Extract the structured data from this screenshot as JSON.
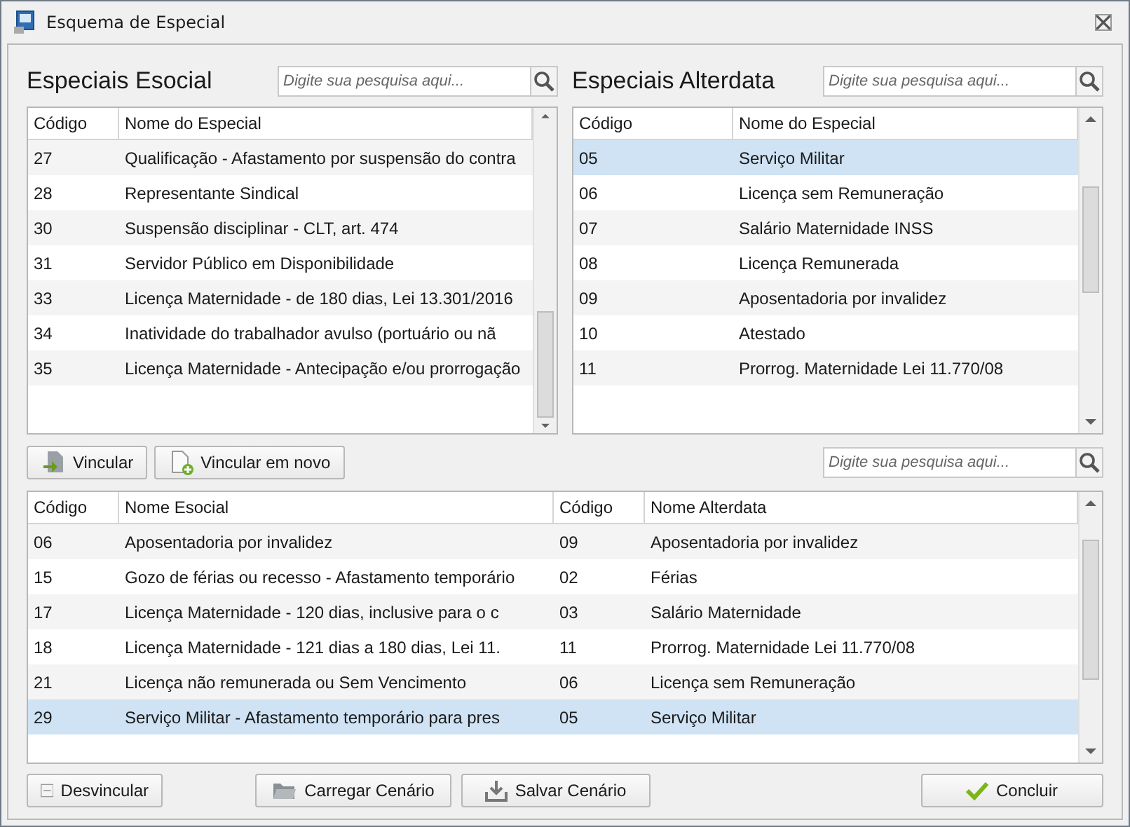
{
  "window": {
    "title": "Esquema de Especial"
  },
  "esocial": {
    "title": "Especiais Esocial",
    "search": {
      "placeholder": "Digite sua pesquisa aqui..."
    },
    "columns": [
      "Código",
      "Nome do Especial"
    ],
    "rows": [
      {
        "code": "27",
        "name": "Qualificação - Afastamento por suspensão do contra",
        "selected": false
      },
      {
        "code": "28",
        "name": "Representante Sindical",
        "selected": false
      },
      {
        "code": "30",
        "name": "Suspensão disciplinar - CLT, art. 474",
        "selected": false
      },
      {
        "code": "31",
        "name": "Servidor Público em Disponibilidade",
        "selected": false
      },
      {
        "code": "33",
        "name": "Licença Maternidade - de 180 dias, Lei 13.301/2016",
        "selected": false
      },
      {
        "code": "34",
        "name": "Inatividade do trabalhador avulso (portuário ou nã",
        "selected": false
      },
      {
        "code": "35",
        "name": "Licença Maternidade - Antecipação e/ou prorrogação",
        "selected": false
      }
    ]
  },
  "alterdata": {
    "title": "Especiais Alterdata",
    "search": {
      "placeholder": "Digite sua pesquisa aqui..."
    },
    "columns": [
      "Código",
      "Nome do Especial"
    ],
    "rows": [
      {
        "code": "05",
        "name": "Serviço Militar",
        "selected": true
      },
      {
        "code": "06",
        "name": "Licença sem Remuneração",
        "selected": false
      },
      {
        "code": "07",
        "name": "Salário Maternidade INSS",
        "selected": false
      },
      {
        "code": "08",
        "name": "Licença Remunerada",
        "selected": false
      },
      {
        "code": "09",
        "name": "Aposentadoria por invalidez",
        "selected": false
      },
      {
        "code": "10",
        "name": "Atestado",
        "selected": false
      },
      {
        "code": "11",
        "name": "Prorrog. Maternidade Lei 11.770/08",
        "selected": false
      }
    ]
  },
  "link_buttons": [
    {
      "label": "Vincular",
      "kind": "link"
    },
    {
      "label": "Vincular em novo",
      "kind": "new"
    }
  ],
  "links": {
    "search": {
      "placeholder": "Digite sua pesquisa aqui..."
    },
    "columns": [
      "Código",
      "Nome Esocial",
      "Código",
      "Nome Alterdata"
    ],
    "rows": [
      {
        "cells": [
          "06",
          "Aposentadoria por invalidez",
          "09",
          "Aposentadoria por invalidez"
        ],
        "selected": false
      },
      {
        "cells": [
          "15",
          "Gozo de férias ou recesso - Afastamento temporário",
          "02",
          "Férias"
        ],
        "selected": false
      },
      {
        "cells": [
          "17",
          "Licença Maternidade - 120 dias, inclusive para o c",
          "03",
          "Salário Maternidade"
        ],
        "selected": false
      },
      {
        "cells": [
          "18",
          "Licença Maternidade - 121 dias a 180 dias, Lei 11.",
          "11",
          "Prorrog. Maternidade Lei 11.770/08"
        ],
        "selected": false
      },
      {
        "cells": [
          "21",
          "Licença não remunerada ou Sem Vencimento",
          "06",
          "Licença sem Remuneração"
        ],
        "selected": false
      },
      {
        "cells": [
          "29",
          "Serviço Militar - Afastamento temporário para pres",
          "05",
          "Serviço Militar"
        ],
        "selected": true
      }
    ]
  },
  "footer_buttons": [
    {
      "label": "Desvincular",
      "kind": "unlink"
    },
    {
      "label": "Carregar Cenário",
      "kind": "load"
    },
    {
      "label": "Salvar Cenário",
      "kind": "save"
    },
    {
      "label": "Concluir",
      "kind": "done"
    }
  ]
}
